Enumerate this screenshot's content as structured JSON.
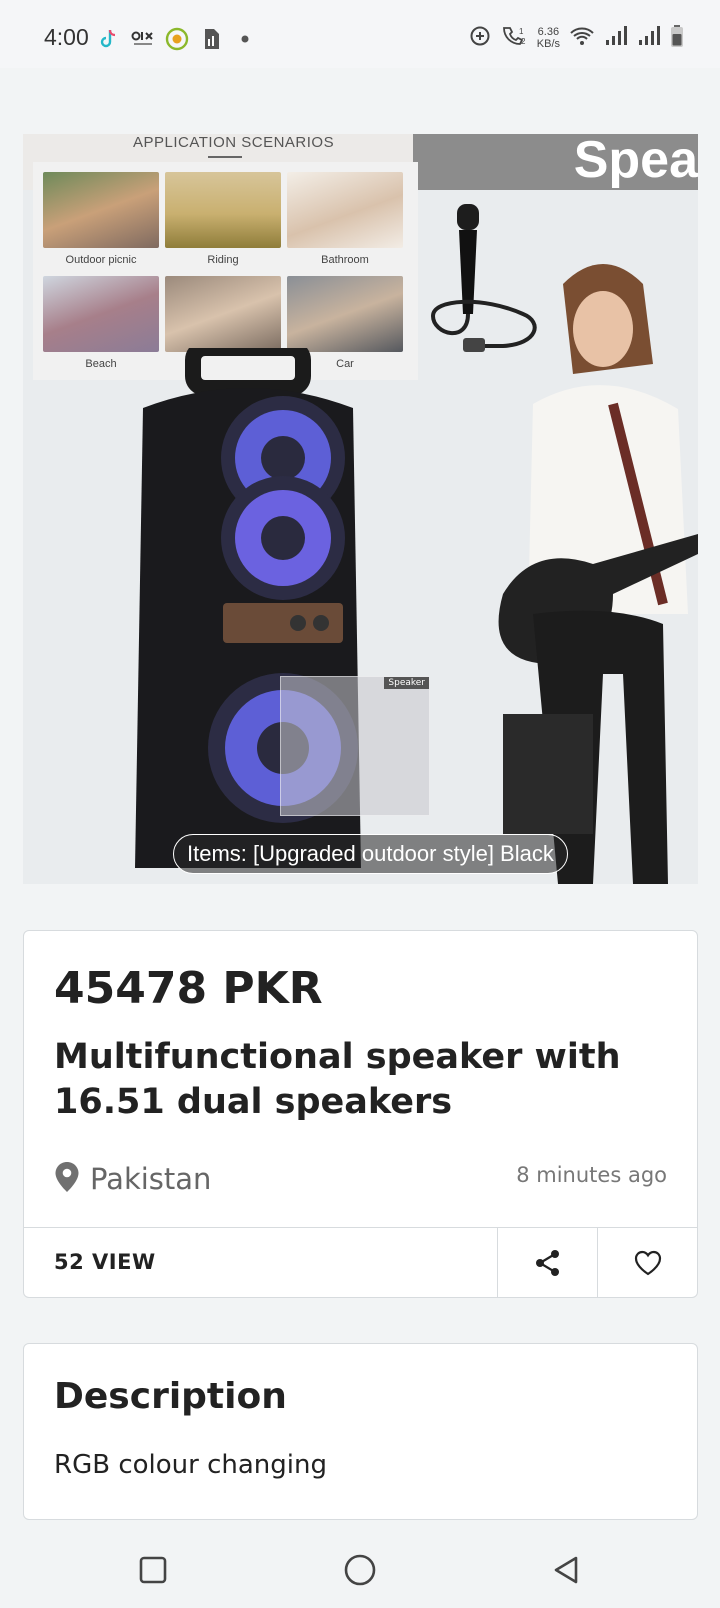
{
  "status_bar": {
    "time": "4:00",
    "net_speed_value": "6.36",
    "net_speed_unit": "KB/s",
    "app_icons": [
      "tiktok-icon",
      "olx-icon",
      "circle-app-icon",
      "sim-app-icon"
    ]
  },
  "hero": {
    "scenarios_title": "APPLICATION SCENARIOS",
    "scenarios": [
      "Outdoor picnic",
      "Riding",
      "Bathroom",
      "Beach",
      "Car"
    ],
    "banner_word": "Spea",
    "thumb_tag": "Speaker",
    "caption": "Items: [Upgraded outdoor style] Black"
  },
  "listing": {
    "price": "45478 PKR",
    "title": "Multifunctional speaker with 16.51 dual speakers",
    "location": "Pakistan",
    "posted": "8 minutes ago",
    "views": "52 VIEW"
  },
  "description": {
    "heading": "Description",
    "text": "RGB colour changing"
  },
  "colors": {
    "background": "#f2f4f5",
    "card": "#ffffff",
    "text": "#222222",
    "muted": "#777777"
  }
}
